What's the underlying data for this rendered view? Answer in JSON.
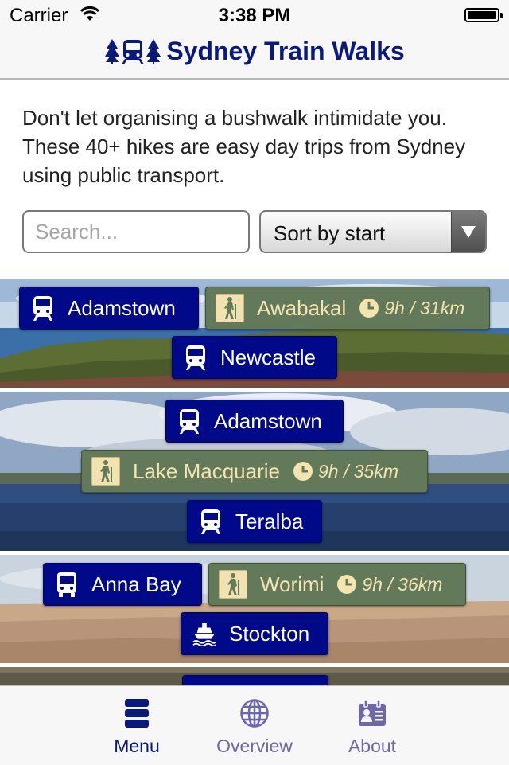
{
  "status_bar": {
    "carrier": "Carrier",
    "time": "3:38 PM"
  },
  "nav": {
    "title": "Sydney Train Walks"
  },
  "intro": "Don't let organising a bushwalk intimidate you. These 40+ hikes are easy day trips from Sydney using public transport.",
  "search": {
    "placeholder": "Search...",
    "value": ""
  },
  "sort": {
    "selected": "Sort by start"
  },
  "walks": [
    {
      "start": "Adamstown",
      "start_mode": "train",
      "name": "Awabakal",
      "duration": "9h / 31km",
      "end": "Newcastle",
      "end_mode": "train",
      "scene": "coast"
    },
    {
      "start": "Adamstown",
      "start_mode": "train",
      "name": "Lake Macquarie",
      "duration": "9h / 35km",
      "end": "Teralba",
      "end_mode": "train",
      "scene": "lake"
    },
    {
      "start": "Anna Bay",
      "start_mode": "bus",
      "name": "Worimi",
      "duration": "9h / 36km",
      "end": "Stockton",
      "end_mode": "ferry",
      "scene": "dunes"
    }
  ],
  "tabs": [
    {
      "label": "Menu",
      "icon": "menu-icon",
      "active": true
    },
    {
      "label": "Overview",
      "icon": "globe-icon",
      "active": false
    },
    {
      "label": "About",
      "icon": "contact-card-icon",
      "active": false
    }
  ],
  "colors": {
    "brand": "#0a1a7a",
    "station_button": "#000a88",
    "route_button": "#637a5a",
    "route_text": "#f4e4b0",
    "tab_active": "#0a1a7a",
    "tab_inactive": "#6b67a8"
  }
}
